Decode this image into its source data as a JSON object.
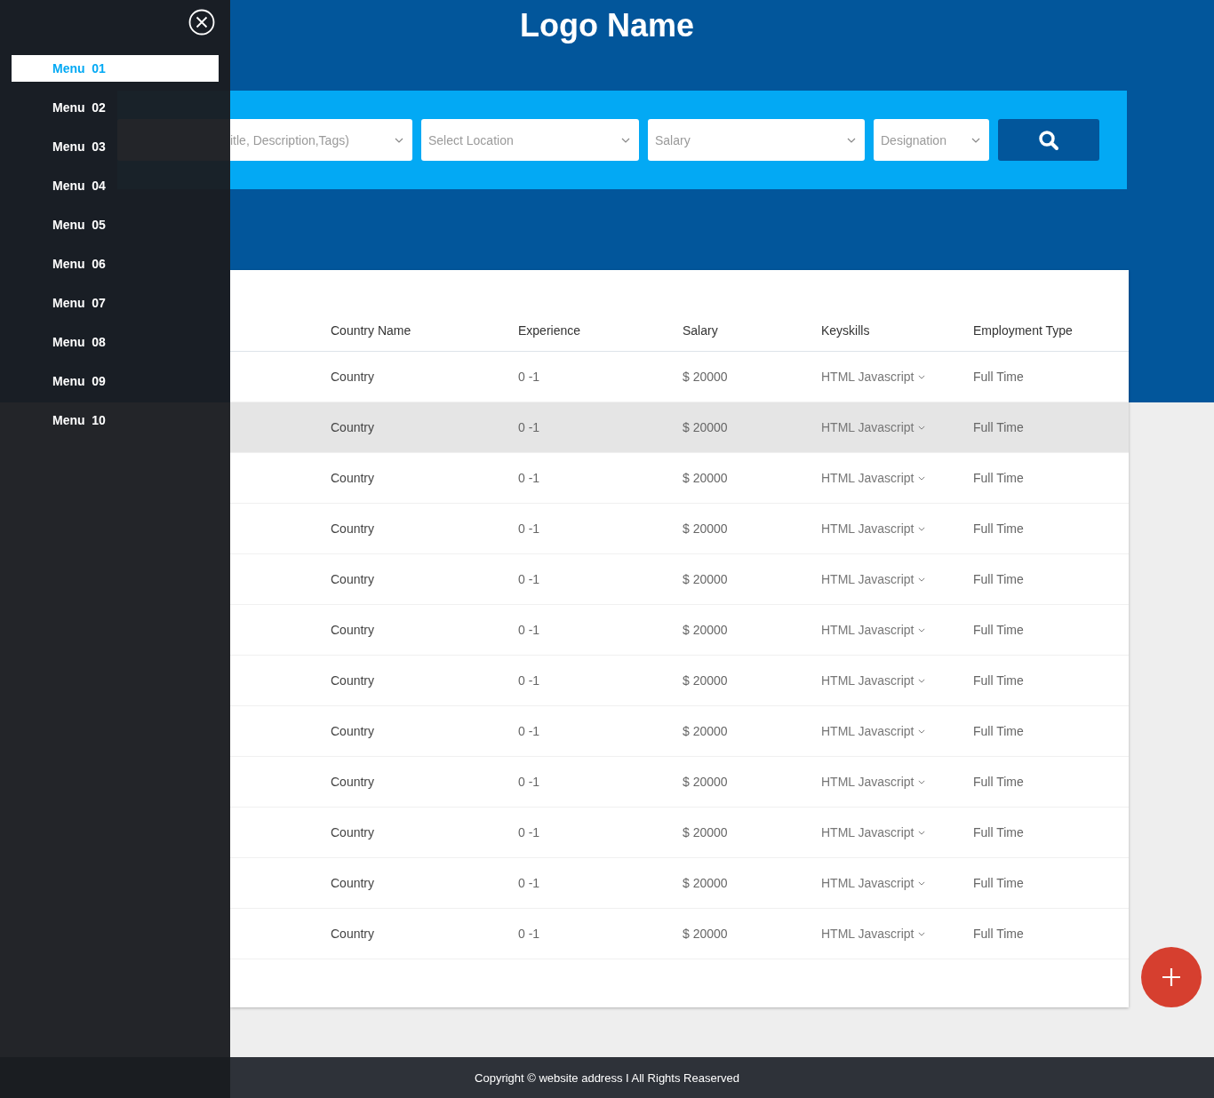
{
  "sidebar": {
    "menu": [
      {
        "label": "Menu  01",
        "selected": true
      },
      {
        "label": "Menu  02",
        "selected": false
      },
      {
        "label": "Menu  03",
        "selected": false
      },
      {
        "label": "Menu  04",
        "selected": false
      },
      {
        "label": "Menu  05",
        "selected": false
      },
      {
        "label": "Menu  06",
        "selected": false
      },
      {
        "label": "Menu  07",
        "selected": false
      },
      {
        "label": "Menu  08",
        "selected": false
      },
      {
        "label": "Menu  09",
        "selected": false
      },
      {
        "label": "Menu  10",
        "selected": false
      }
    ]
  },
  "header": {
    "logo": "Logo Name"
  },
  "search": {
    "fields": [
      {
        "placeholder": "itle, Description,Tags)"
      },
      {
        "placeholder": "Select Location"
      },
      {
        "placeholder": "Salary"
      },
      {
        "placeholder": "Designation"
      }
    ]
  },
  "table": {
    "columns": [
      "Country Name",
      "Experience",
      "Salary",
      "Keyskills",
      "Employment Type"
    ],
    "rows": [
      {
        "country": "Country",
        "experience": "0 -1",
        "salary": "$ 20000",
        "keyskills": "HTML Javascript",
        "employment": "Full Time",
        "highlighted": false
      },
      {
        "country": "Country",
        "experience": "0 -1",
        "salary": "$ 20000",
        "keyskills": "HTML Javascript",
        "employment": "Full Time",
        "highlighted": true
      },
      {
        "country": "Country",
        "experience": "0 -1",
        "salary": "$ 20000",
        "keyskills": "HTML Javascript",
        "employment": "Full Time",
        "highlighted": false
      },
      {
        "country": "Country",
        "experience": "0 -1",
        "salary": "$ 20000",
        "keyskills": "HTML Javascript",
        "employment": "Full Time",
        "highlighted": false
      },
      {
        "country": "Country",
        "experience": "0 -1",
        "salary": "$ 20000",
        "keyskills": "HTML Javascript",
        "employment": "Full Time",
        "highlighted": false
      },
      {
        "country": "Country",
        "experience": "0 -1",
        "salary": "$ 20000",
        "keyskills": "HTML Javascript",
        "employment": "Full Time",
        "highlighted": false
      },
      {
        "country": "Country",
        "experience": "0 -1",
        "salary": "$ 20000",
        "keyskills": "HTML Javascript",
        "employment": "Full Time",
        "highlighted": false
      },
      {
        "country": "Country",
        "experience": "0 -1",
        "salary": "$ 20000",
        "keyskills": "HTML Javascript",
        "employment": "Full Time",
        "highlighted": false
      },
      {
        "country": "Country",
        "experience": "0 -1",
        "salary": "$ 20000",
        "keyskills": "HTML Javascript",
        "employment": "Full Time",
        "highlighted": false
      },
      {
        "country": "Country",
        "experience": "0 -1",
        "salary": "$ 20000",
        "keyskills": "HTML Javascript",
        "employment": "Full Time",
        "highlighted": false
      },
      {
        "country": "Country",
        "experience": "0 -1",
        "salary": "$ 20000",
        "keyskills": "HTML Javascript",
        "employment": "Full Time",
        "highlighted": false
      },
      {
        "country": "Country",
        "experience": "0 -1",
        "salary": "$ 20000",
        "keyskills": "HTML Javascript",
        "employment": "Full Time",
        "highlighted": false
      }
    ]
  },
  "footer": {
    "text": "Copyright © website address I All Rights Reaserved"
  }
}
